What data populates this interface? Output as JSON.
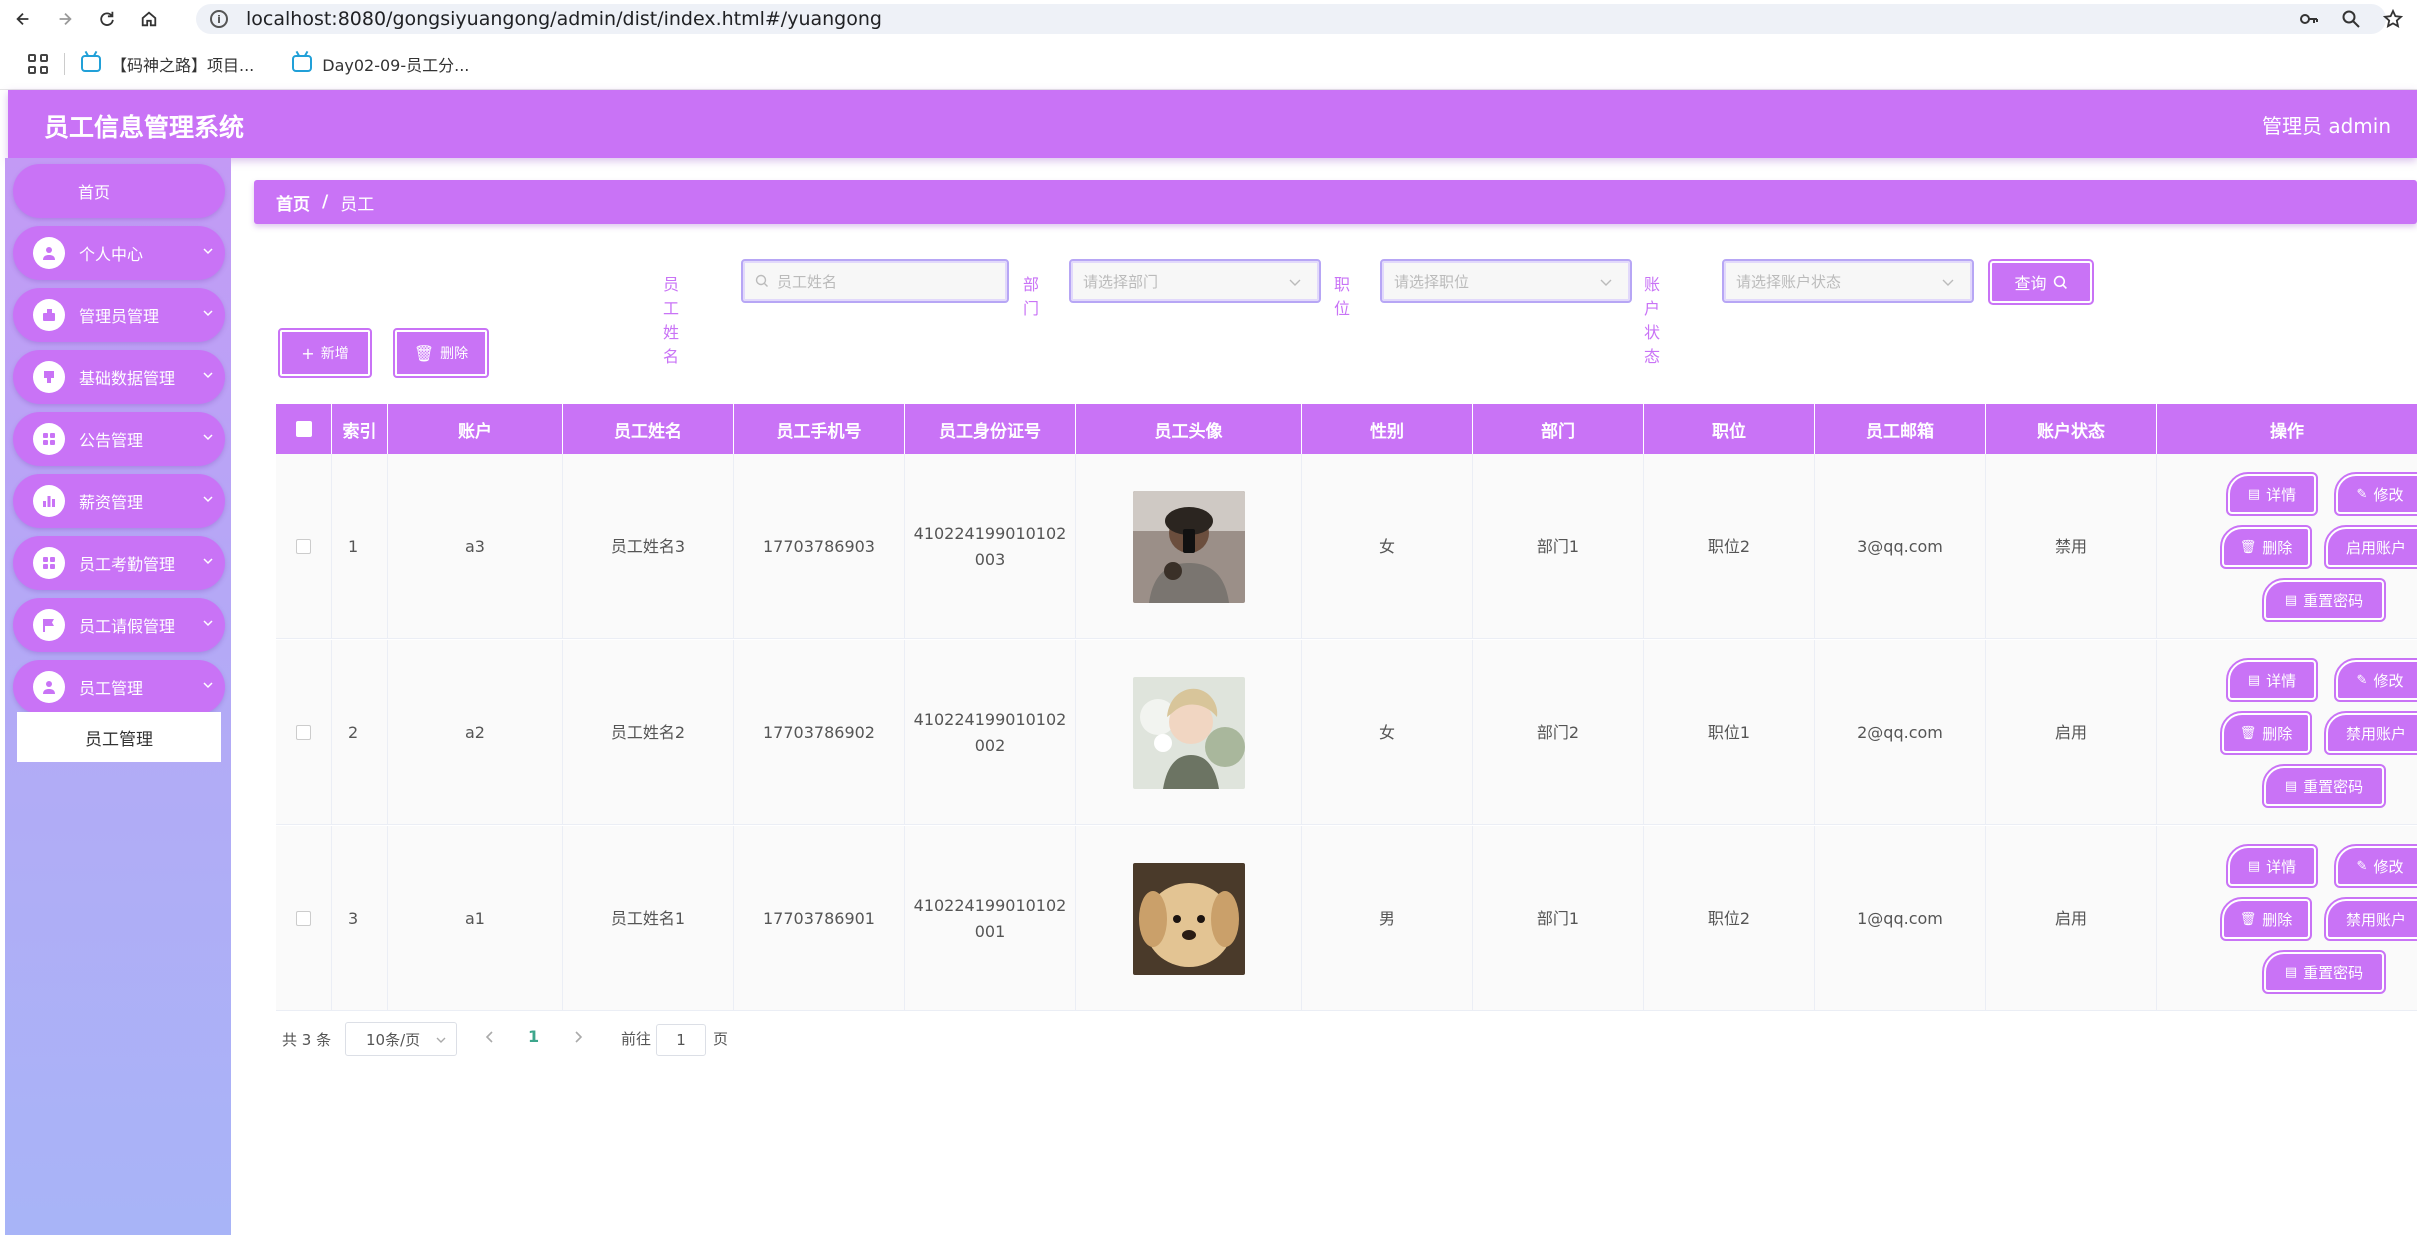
{
  "browser": {
    "url": "localhost:8080/gongsiyuangong/admin/dist/index.html#/yuangong",
    "bookmarks": [
      "【码神之路】项目...",
      "Day02-09-员工分..."
    ]
  },
  "header": {
    "title": "员工信息管理系统",
    "user": "管理员 admin"
  },
  "sidebar": {
    "items": [
      {
        "label": "首页",
        "icon": "home"
      },
      {
        "label": "个人中心",
        "icon": "user-icon"
      },
      {
        "label": "管理员管理",
        "icon": "admin-icon"
      },
      {
        "label": "基础数据管理",
        "icon": "data-icon"
      },
      {
        "label": "公告管理",
        "icon": "grid-icon"
      },
      {
        "label": "薪资管理",
        "icon": "chart-icon"
      },
      {
        "label": "员工考勤管理",
        "icon": "grid-icon"
      },
      {
        "label": "员工请假管理",
        "icon": "flag-icon"
      },
      {
        "label": "员工管理",
        "icon": "user-icon"
      }
    ],
    "active_sub": "员工管理"
  },
  "breadcrumb": {
    "home": "首页",
    "sep": "/",
    "current": "员工"
  },
  "search": {
    "name_label": "员工姓名",
    "name_placeholder": "员工姓名",
    "dept_label": "部门",
    "dept_placeholder": "请选择部门",
    "position_label": "职位",
    "position_placeholder": "请选择职位",
    "status_label": "账户状态",
    "status_placeholder": "请选择账户状态",
    "query": "查询"
  },
  "actions": {
    "add": "新增",
    "delete": "删除"
  },
  "table": {
    "headers": [
      "索引",
      "账户",
      "员工姓名",
      "员工手机号",
      "员工身份证号",
      "员工头像",
      "性别",
      "部门",
      "职位",
      "员工邮箱",
      "账户状态",
      "操作"
    ],
    "rows": [
      {
        "index": "1",
        "account": "a3",
        "name": "员工姓名3",
        "phone": "17703786903",
        "idcard1": "410224199010102",
        "idcard2": "003",
        "gender": "女",
        "dept": "部门1",
        "position": "职位2",
        "email": "3@qq.com",
        "status": "禁用",
        "toggle": "启用账户"
      },
      {
        "index": "2",
        "account": "a2",
        "name": "员工姓名2",
        "phone": "17703786902",
        "idcard1": "410224199010102",
        "idcard2": "002",
        "gender": "女",
        "dept": "部门2",
        "position": "职位1",
        "email": "2@qq.com",
        "status": "启用",
        "toggle": "禁用账户"
      },
      {
        "index": "3",
        "account": "a1",
        "name": "员工姓名1",
        "phone": "17703786901",
        "idcard1": "410224199010102",
        "idcard2": "001",
        "gender": "男",
        "dept": "部门1",
        "position": "职位2",
        "email": "1@qq.com",
        "status": "启用",
        "toggle": "禁用账户"
      }
    ],
    "ops": {
      "detail": "详情",
      "edit": "修改",
      "delete": "删除",
      "reset": "重置密码"
    }
  },
  "pagination": {
    "total": "共 3 条",
    "size": "10条/页",
    "current": "1",
    "goto": "前往",
    "page_input": "1",
    "page_suffix": "页"
  },
  "colors": {
    "accent": "#c973f6",
    "sidebar_top": "#c39af5",
    "sidebar_bottom": "#a8b4f7",
    "page_active": "#3da68c"
  }
}
